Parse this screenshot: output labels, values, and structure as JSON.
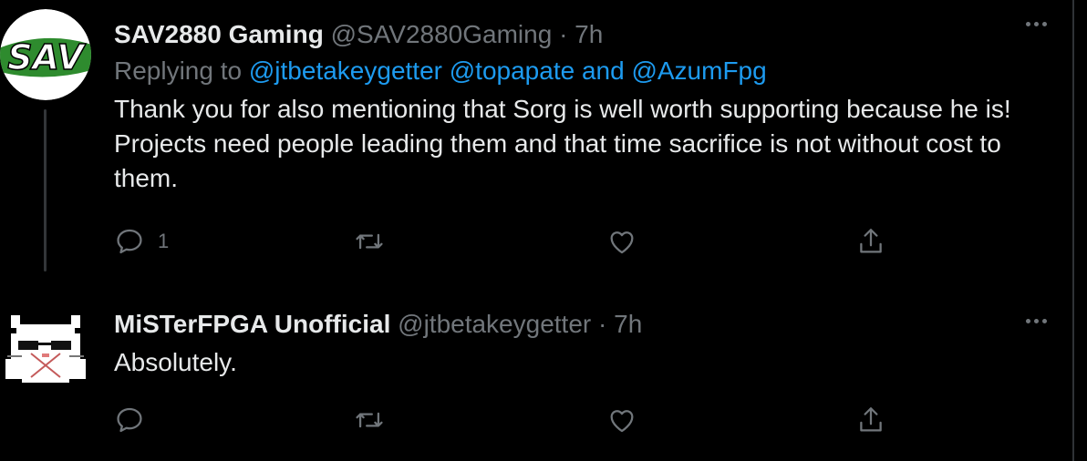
{
  "tweets": [
    {
      "display_name": "SAV2880 Gaming",
      "handle": "@SAV2880Gaming",
      "separator": "·",
      "time": "7h",
      "avatar_text": "SAV",
      "replying_prefix": "Replying to",
      "mention_1": "@jtbetakeygetter",
      "mention_2": "@topapate",
      "conjunction": "and",
      "mention_3": "@AzumFpg",
      "body": "Thank you for also mentioning that Sorg is well worth supporting because he is! Projects need people leading them and that time sacrifice is not without cost to them.",
      "reply_count": "1",
      "icons": [
        "reply-icon",
        "retweet-icon",
        "like-icon",
        "share-icon",
        "more-icon"
      ]
    },
    {
      "display_name": "MiSTerFPGA Unofficial",
      "handle": "@jtbetakeygetter",
      "separator": "·",
      "time": "7h",
      "body": "Absolutely.",
      "icons": [
        "reply-icon",
        "retweet-icon",
        "like-icon",
        "share-icon",
        "more-icon"
      ]
    }
  ],
  "colors": {
    "background": "#000000",
    "text_primary": "#e7e9ea",
    "text_secondary": "#71767b",
    "link": "#1d9bf0",
    "thread_line": "#333639",
    "sav_logo_green": "#2e8b2e"
  }
}
